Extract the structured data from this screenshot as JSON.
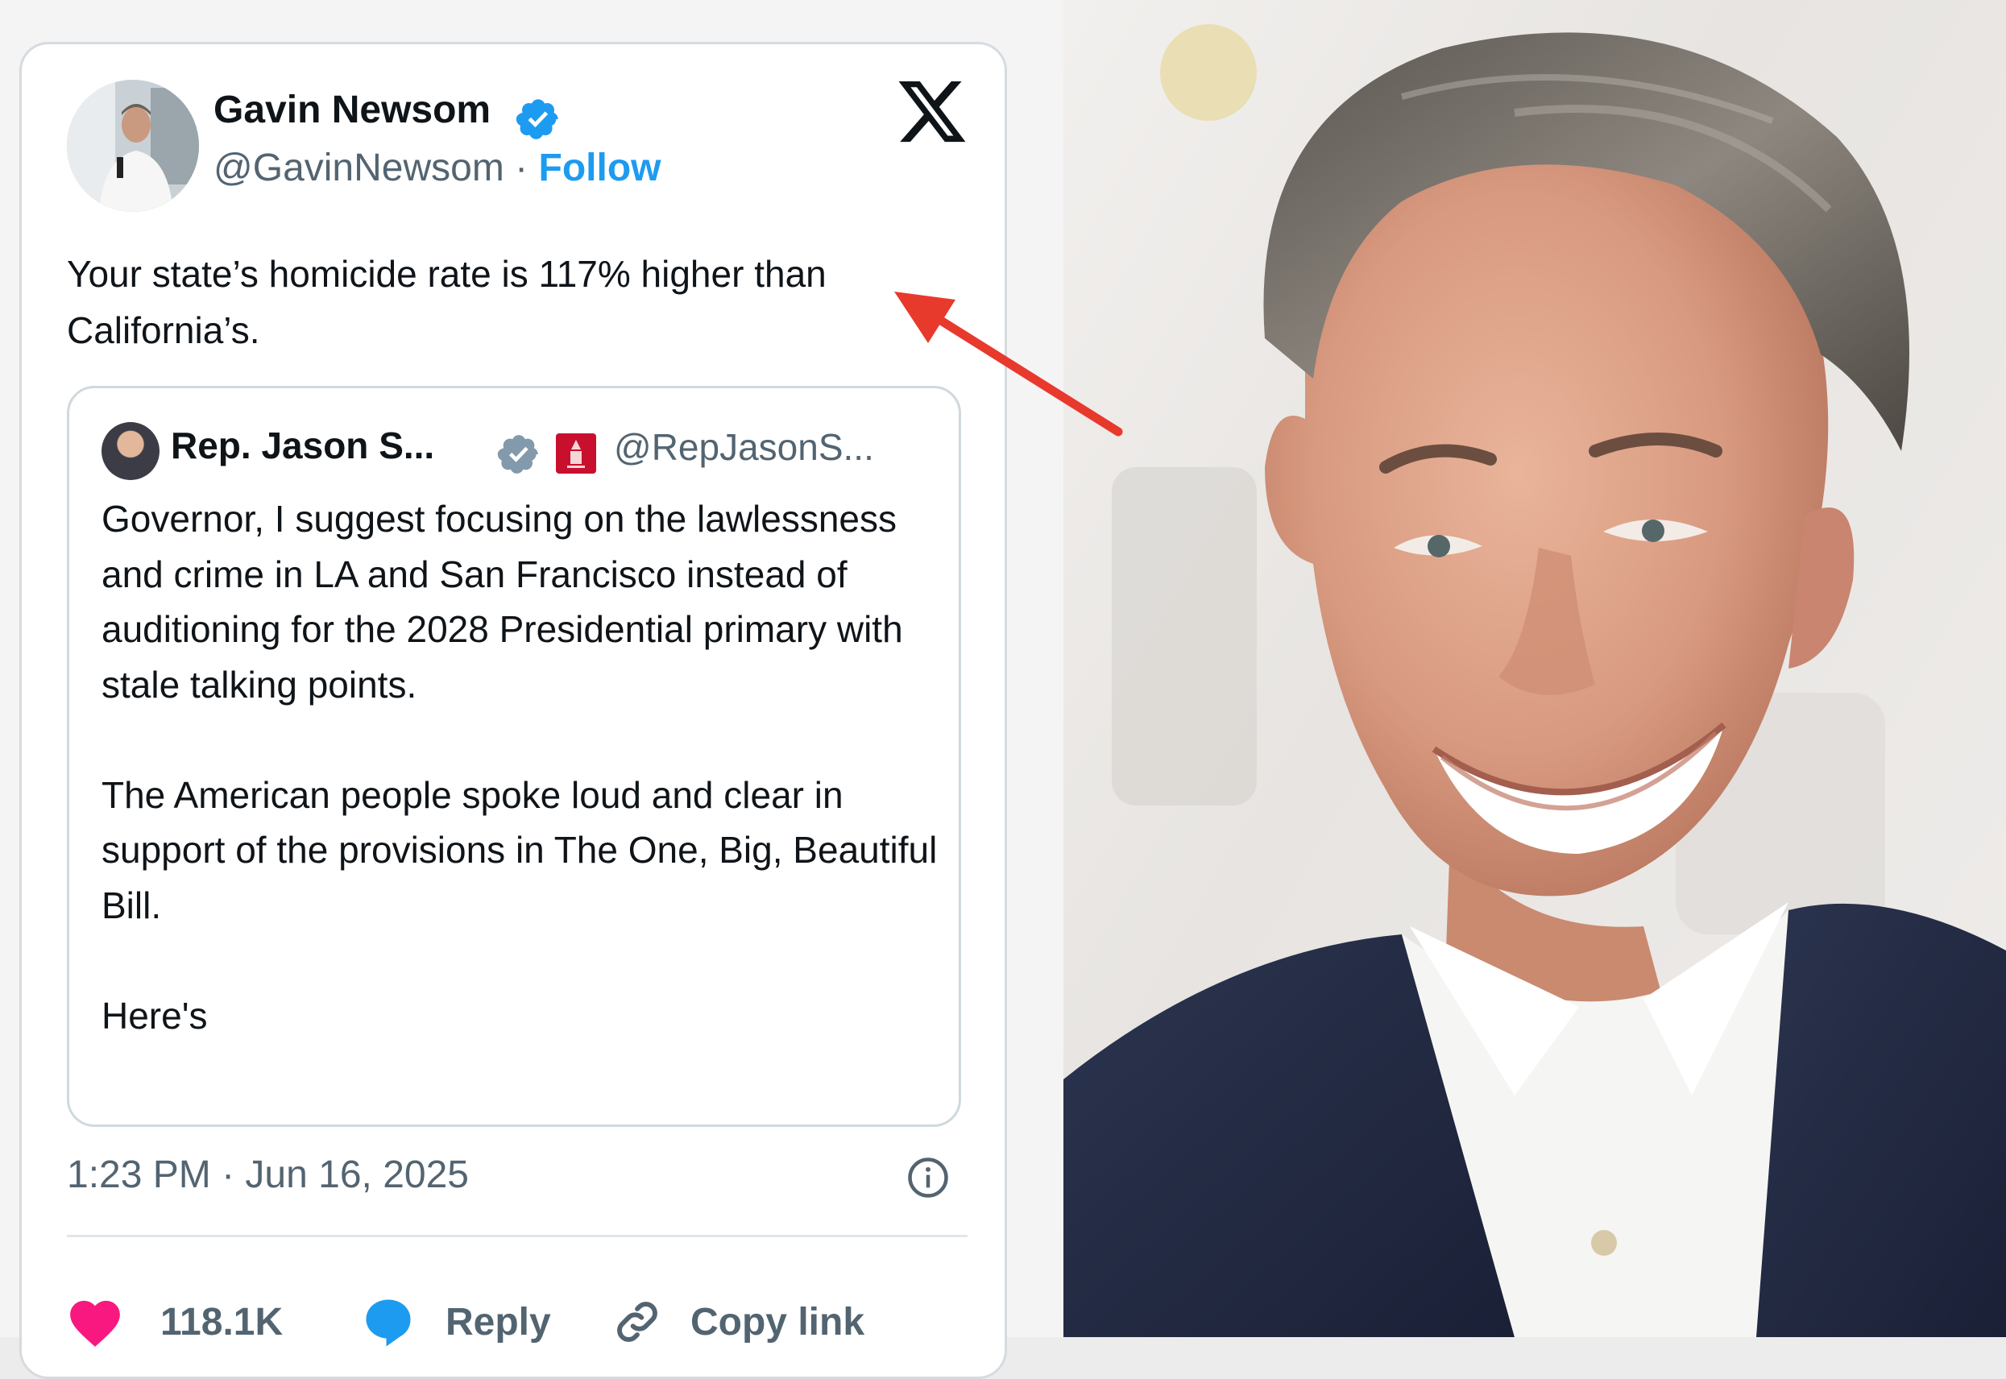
{
  "tweet": {
    "author_name": "Gavin Newsom",
    "handle": "@GavinNewsom",
    "separator": "·",
    "follow_label": "Follow",
    "text": "Your state’s homicide rate is 117% higher than California’s.",
    "timestamp": "1:23 PM · Jun 16, 2025",
    "likes": "118.1K",
    "reply_label": "Reply",
    "copy_link_label": "Copy link"
  },
  "quote": {
    "author_name": "Rep. Jason S...",
    "handle": "@RepJasonS...",
    "paragraphs": [
      "Governor, I suggest focusing on the lawlessness and crime in LA and San Francisco instead of auditioning for the 2028 Presidential primary with stale talking points.",
      "The American people spoke loud and clear in support of the provisions in The One, Big, Beautiful Bill.",
      "Here's"
    ]
  },
  "icons": {
    "verified": "verified-badge-icon",
    "x_logo": "x-logo-icon",
    "heart": "heart-icon",
    "reply": "reply-bubble-icon",
    "link": "link-icon",
    "info": "info-icon",
    "seal": "congress-seal-icon"
  },
  "colors": {
    "link_blue": "#1d9bf0",
    "heart_pink": "#f91880",
    "arrow_red": "#e8392d",
    "muted_text": "#536471"
  }
}
